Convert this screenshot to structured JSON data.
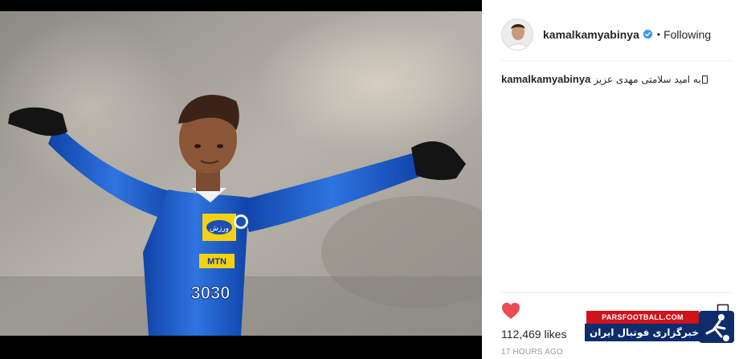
{
  "post": {
    "username": "kamalkamyabinya",
    "follow_status": "Following",
    "separator": "•",
    "caption_username": "kamalkamyabinya",
    "caption_text": "به امید سلامتی مهدی عزیز",
    "likes": "112,469 likes",
    "timestamp": "17 HOURS AGO"
  },
  "photo": {
    "jersey_number": "3030",
    "sponsor_text": "MTN",
    "crest_text": "ورزش"
  },
  "watermark": {
    "site": "PARSFOOTBALL.COM",
    "tagline": "خبرگزاری فوتبال ایران"
  },
  "icons": {
    "verified": "verified-badge-icon",
    "like": "heart-icon",
    "save": "bookmark-icon"
  },
  "colors": {
    "heart": "#ed4956",
    "verified": "#3897f0",
    "jersey": "#1c5bc7",
    "watermark_red": "#d0121b",
    "watermark_blue": "#0d2c6c"
  }
}
